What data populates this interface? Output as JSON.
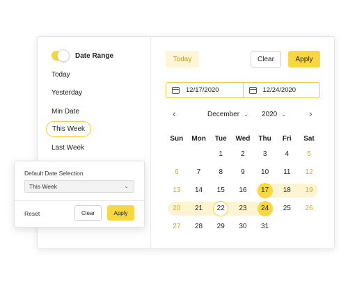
{
  "sidebar": {
    "toggle_label": "Date Range",
    "toggle_on": true,
    "presets": [
      {
        "label": "Today",
        "selected": false
      },
      {
        "label": "Yesterday",
        "selected": false
      },
      {
        "label": "Min Date",
        "selected": false
      },
      {
        "label": "This Week",
        "selected": true
      },
      {
        "label": "Last Week",
        "selected": false
      }
    ]
  },
  "toolbar": {
    "today_label": "Today",
    "clear_label": "Clear",
    "apply_label": "Apply"
  },
  "range": {
    "start": "12/17/2020",
    "end": "12/24/2020"
  },
  "calendar": {
    "month": "December",
    "year": "2020",
    "weekdays": [
      "Sun",
      "Mon",
      "Tue",
      "Wed",
      "Thu",
      "Fri",
      "Sat"
    ],
    "weeks": [
      [
        "",
        "",
        "1",
        "2",
        "3",
        "4",
        "5"
      ],
      [
        "6",
        "7",
        "8",
        "9",
        "10",
        "11",
        "12"
      ],
      [
        "13",
        "14",
        "15",
        "16",
        "17",
        "18",
        "19"
      ],
      [
        "20",
        "21",
        "22",
        "23",
        "24",
        "25",
        "26"
      ],
      [
        "27",
        "28",
        "29",
        "30",
        "31",
        "",
        ""
      ]
    ],
    "selected_start": "17",
    "selected_end": "24",
    "today": "22"
  },
  "popup": {
    "label": "Default Date Selection",
    "select_value": "This Week",
    "reset_label": "Reset",
    "clear_label": "Clear",
    "apply_label": "Apply"
  },
  "colors": {
    "accent": "#f7d842",
    "weekend": "#d9aa1a",
    "range_band": "#fdf4d2"
  },
  "icons": {
    "toggle": "toggle-switch",
    "calendar": "calendar-icon",
    "prev": "chevron-left-icon",
    "next": "chevron-right-icon",
    "dropdown": "chevron-down-icon"
  }
}
